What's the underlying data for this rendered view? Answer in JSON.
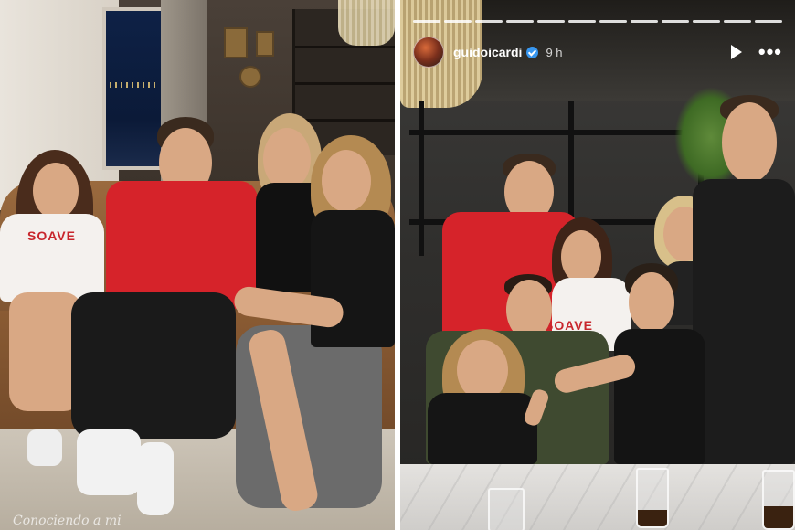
{
  "left_photo": {
    "caption": "Conociendo a mi",
    "shirt_text": "SOAVE"
  },
  "right_photo": {
    "story": {
      "username": "guidoicardi",
      "timestamp": "9 h",
      "progress_segments": 12
    },
    "shirt_text": "SOAVE"
  },
  "icons": {
    "play": "play-icon",
    "more": "more-icon",
    "verified": "verified-badge-icon"
  },
  "colors": {
    "verified": "#3897f0",
    "red_shirt": "#d6232a"
  }
}
